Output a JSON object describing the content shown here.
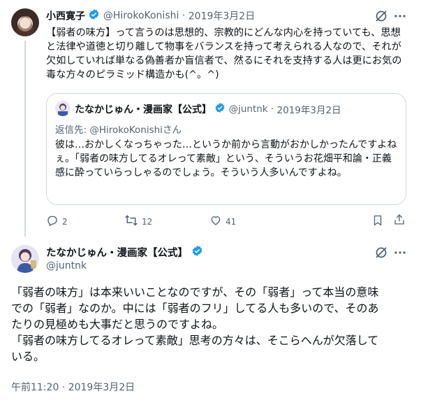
{
  "tweet1": {
    "display_name": "小西寛子",
    "handle": "@HirokoKonishi",
    "separator": "·",
    "date": "2019年3月2日",
    "text": "【弱者の味方】って言うのは思想的、宗教的にどんな内心を持っていても、思想と法律や道徳と切り離して物事をバランスを持って考えられる人なので、それが欠如していれば単なる偽善者か盲信者で、然るにそれを支持する人は更にお気の毒な方々のピラミッド構造かも(^。^)"
  },
  "quote": {
    "display_name": "たなかじゅん・漫画家【公式】",
    "handle": "@juntnk",
    "separator": "·",
    "date": "2019年3月2日",
    "reply_to": "返信先: @HirokoKonishiさん",
    "text": "彼は…おかしくなっちゃった…というか前から言動がおかしかったんですよねぇ。「弱者の味方してるオレって素敵」という、そういうお花畑平和論・正義感に酔っていらっしゃるのでしょう。そういう人多いんですよね。"
  },
  "actions": {
    "reply_count": "2",
    "retweet_count": "12",
    "like_count": "41"
  },
  "tweet2": {
    "display_name": "たなかじゅん・漫画家【公式】",
    "handle": "@juntnk",
    "text_lines": [
      "「弱者の味方」は本来いいことなのですが、その「弱者」って本当の意味",
      "での「弱者」なのか。中には「弱者のフリ」してる人も多いので、そのあ",
      "たりの見極めも大事だと思うのですよね。",
      "「弱者の味方してるオレって素敵」思考の方々は、そこらへんが欠落して",
      "いる。"
    ],
    "timestamp": "午前11:20 · 2019年3月2日"
  },
  "colors": {
    "verified_blue": "#1d9bf0",
    "secondary_text": "#536471",
    "border": "#cfd9de"
  }
}
